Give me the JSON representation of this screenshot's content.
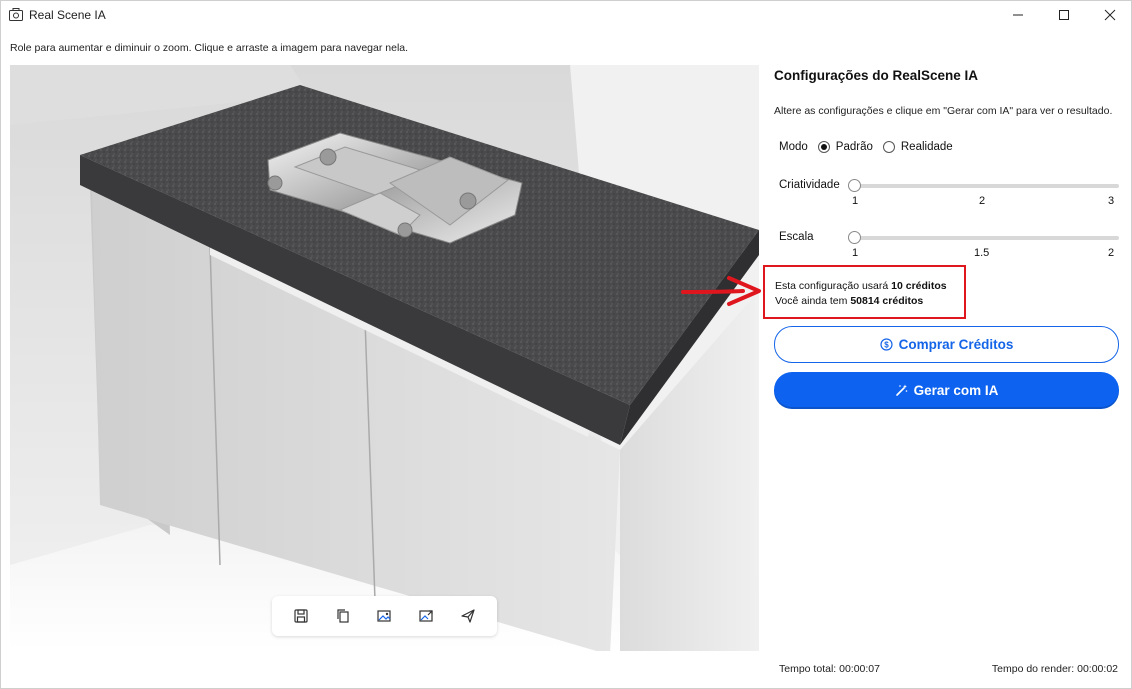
{
  "window": {
    "title": "Real Scene IA",
    "icons": {
      "app": "camera-icon",
      "minimize": "minimize-icon",
      "maximize": "maximize-icon",
      "close": "close-icon"
    }
  },
  "viewer": {
    "hint": "Role para aumentar e diminuir o zoom. Clique e arraste a imagem para navegar nela.",
    "toolbar": [
      "save-icon",
      "copy-icon",
      "image-edit-icon",
      "image-export-icon",
      "send-icon"
    ]
  },
  "settings": {
    "title": "Configurações do RealScene IA",
    "description": "Altere as configurações e clique em \"Gerar com IA\" para ver o resultado.",
    "mode": {
      "label": "Modo",
      "options": [
        "Padrão",
        "Realidade"
      ],
      "selected": "Padrão"
    },
    "creativity": {
      "label": "Criatividade",
      "ticks": [
        "1",
        "2",
        "3"
      ],
      "value": 1
    },
    "scale": {
      "label": "Escala",
      "ticks": [
        "1",
        "1.5",
        "2"
      ],
      "value": 1
    },
    "credits": {
      "usage_prefix": "Esta configuração usará ",
      "usage_value": "10 créditos",
      "balance_prefix": "Você ainda tem ",
      "balance_value": "50814 créditos"
    },
    "buy_button": "Comprar Créditos",
    "generate_button": "Gerar com IA",
    "accent_color": "#0d63f0",
    "highlight_color": "#e0161e"
  },
  "footer": {
    "total_time": "Tempo total: 00:00:07",
    "render_time": "Tempo do render: 00:00:02"
  }
}
